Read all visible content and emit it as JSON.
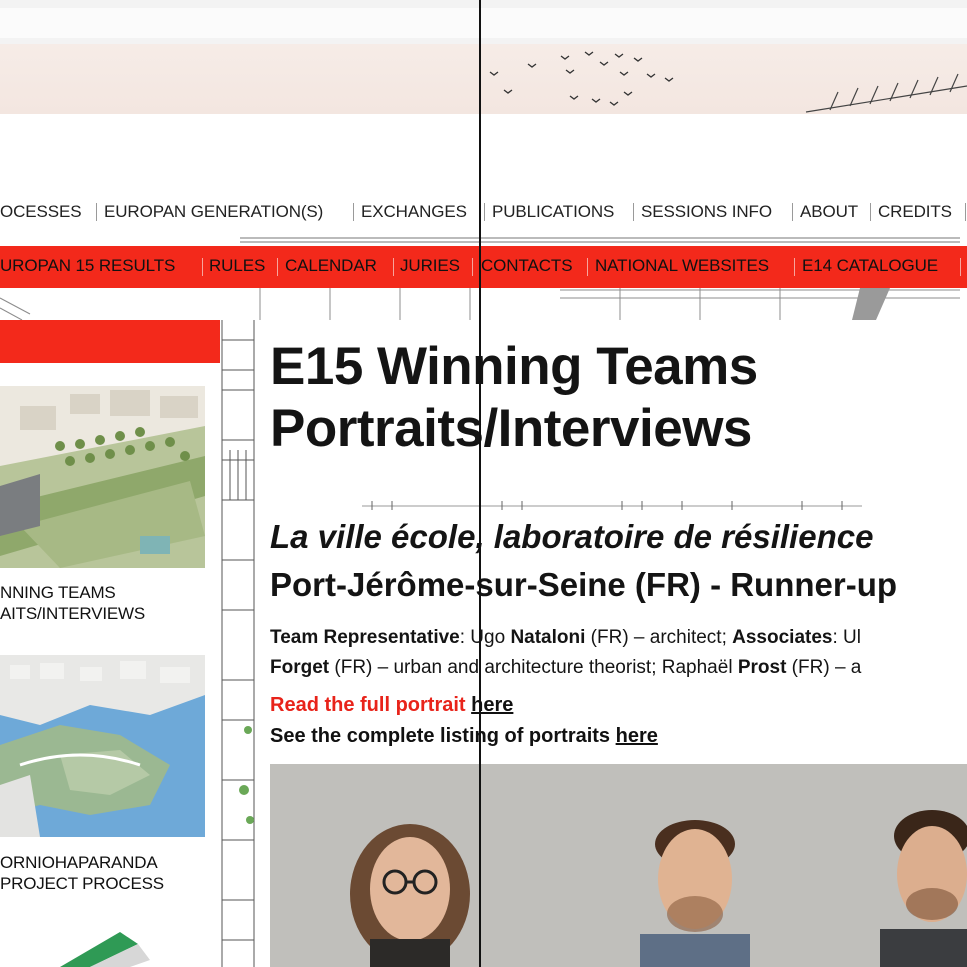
{
  "main_nav": {
    "items": [
      "OCESSES",
      "EUROPAN GENERATION(S)",
      "EXCHANGES",
      "PUBLICATIONS",
      "SESSIONS INFO",
      "ABOUT",
      "CREDITS"
    ]
  },
  "sub_nav": {
    "items": [
      "UROPAN 15 RESULTS",
      "RULES",
      "CALENDAR",
      "JURIES",
      "CONTACTS",
      "NATIONAL WEBSITES",
      "E14 CATALOGUE"
    ]
  },
  "sidebar": {
    "cards": [
      {
        "line1": "NNING TEAMS",
        "line2": "AITS/INTERVIEWS"
      },
      {
        "line1": "ORNIOHAPARANDA",
        "line2": "PROJECT PROCESS"
      }
    ]
  },
  "article": {
    "title_line1": "E15 Winning Teams",
    "title_line2": "Portraits/Interviews",
    "project_title": "La ville école, laboratoire de résilience",
    "site_line": "Port-Jérôme-sur-Seine (FR) - Runner-up",
    "team_label": "Team Representative",
    "team_rep_pre": ": Ugo ",
    "team_rep_name": "Nataloni",
    "team_rep_post": " (FR) – architect; ",
    "associates_label": "Associates",
    "associates_pre": ": Ul",
    "line2_name1": "Forget",
    "line2_mid": " (FR) – urban and architecture theorist; Raphaël ",
    "line2_name2": "Prost",
    "line2_post": " (FR) – a",
    "read_text": "Read the full portrait",
    "read_link": "here",
    "see_text": "See the complete listing of portraits",
    "see_link": "here"
  },
  "colors": {
    "accent_red": "#f3291b",
    "link_red": "#e8231a"
  }
}
